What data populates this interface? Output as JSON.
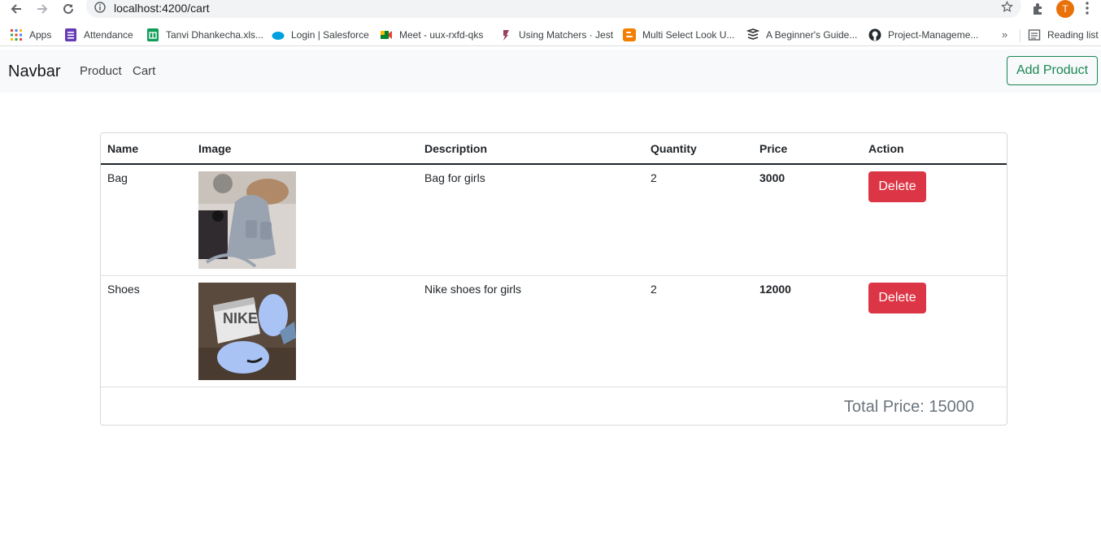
{
  "browser": {
    "url": "localhost:4200/cart",
    "avatar_initial": "T",
    "bookmarks": [
      {
        "label": "Apps",
        "icon": "apps-grid-icon",
        "color": "#4285f4"
      },
      {
        "label": "Attendance",
        "icon": "forms-icon",
        "color": "#673ab7"
      },
      {
        "label": "Tanvi Dhankecha.xls...",
        "icon": "sheets-icon",
        "color": "#0f9d58"
      },
      {
        "label": "Login | Salesforce",
        "icon": "salesforce-icon",
        "color": "#00a1e0"
      },
      {
        "label": "Meet - uux-rxfd-qks",
        "icon": "meet-icon",
        "color": "#00832d"
      },
      {
        "label": "Using Matchers · Jest",
        "icon": "jest-icon",
        "color": "#99425b"
      },
      {
        "label": "Multi Select Look U...",
        "icon": "blogger-icon",
        "color": "#f57d00"
      },
      {
        "label": "A Beginner's Guide...",
        "icon": "layers-icon",
        "color": "#333333"
      },
      {
        "label": "Project-Manageme...",
        "icon": "github-icon",
        "color": "#24292e"
      }
    ],
    "more_label": "»",
    "reading_list": "Reading list"
  },
  "navbar": {
    "brand": "Navbar",
    "links": [
      "Product",
      "Cart"
    ],
    "add_product": "Add Product"
  },
  "cart": {
    "headers": [
      "Name",
      "Image",
      "Description",
      "Quantity",
      "Price",
      "Action"
    ],
    "rows": [
      {
        "name": "Bag",
        "image": "grey-backpack-photo",
        "description": "Bag for girls",
        "quantity": "2",
        "price": "3000",
        "action": "Delete"
      },
      {
        "name": "Shoes",
        "image": "blue-nike-sneakers-photo",
        "description": "Nike shoes for girls",
        "quantity": "2",
        "price": "12000",
        "action": "Delete"
      }
    ],
    "total_label": "Total Price: 15000"
  },
  "colors": {
    "success": "#198754",
    "danger": "#dc3545",
    "navbar_bg": "#f8f9fa"
  }
}
